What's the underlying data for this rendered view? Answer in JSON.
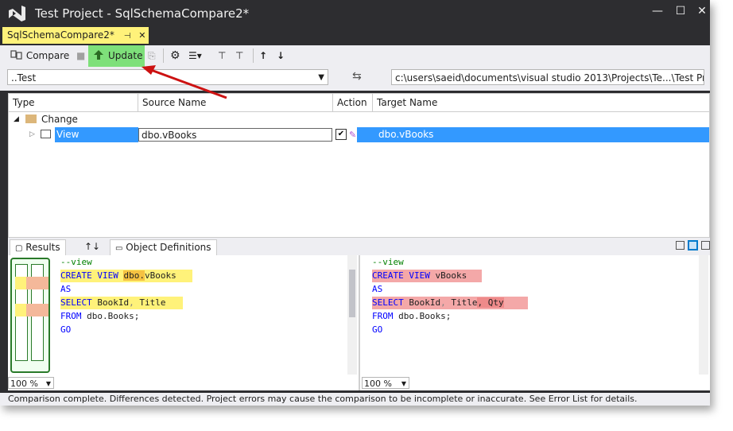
{
  "window": {
    "title": "Test Project - SqlSchemaCompare2*",
    "min": "—",
    "max": "☐",
    "close": "✕"
  },
  "doc_tab": {
    "label": "SqlSchemaCompare2*",
    "pin": "⊣",
    "close": "✕"
  },
  "toolbar": {
    "compare_label": "Compare",
    "update_label": "Update",
    "colors": {
      "update_highlight": "#7ee07a",
      "arrow": "#cc1111"
    }
  },
  "pathbar": {
    "source_value": "..Test",
    "swap_icon": "⇆",
    "target_value": "c:\\users\\saeid\\documents\\visual studio 2013\\Projects\\Te...\\Test Project"
  },
  "grid": {
    "headers": [
      "Type",
      "Source Name",
      "Action",
      "Target Name"
    ],
    "group_label": "Change",
    "row": {
      "type": "View",
      "source": "dbo.vBooks",
      "target": "dbo.vBooks",
      "checked": true
    }
  },
  "bottom_tabs": {
    "results": "Results",
    "sort": "↑↓",
    "object_definitions": "Object Definitions"
  },
  "source_code": {
    "lines": [
      {
        "t": [
          [
            "--view",
            "cm"
          ]
        ]
      },
      {
        "t": [
          [
            "CREATE VIEW ",
            "kw"
          ],
          [
            "dbo.",
            "hl-o"
          ],
          [
            "vBooks",
            ""
          ]
        ]
      },
      {
        "t": [
          [
            "AS",
            "kw"
          ]
        ]
      },
      {
        "t": [
          [
            "SELECT ",
            "kw"
          ],
          [
            "BookId",
            ""
          ],
          [
            ", ",
            "gry"
          ],
          [
            "Title",
            ""
          ]
        ]
      },
      {
        "t": [
          [
            "FROM ",
            "kw"
          ],
          [
            "dbo.Books;",
            ""
          ]
        ]
      },
      {
        "t": [
          [
            "GO",
            "kw"
          ]
        ]
      }
    ],
    "zoom": "100 %"
  },
  "target_code": {
    "lines": [
      {
        "t": [
          [
            "--view",
            "cm"
          ]
        ]
      },
      {
        "t": [
          [
            "CREATE VIEW ",
            "kw"
          ],
          [
            "vBooks",
            ""
          ]
        ]
      },
      {
        "t": [
          [
            "AS",
            "kw"
          ]
        ]
      },
      {
        "t": [
          [
            "SELECT ",
            "kw"
          ],
          [
            "BookId",
            ""
          ],
          [
            ", ",
            "gry"
          ],
          [
            "Title",
            ""
          ],
          [
            ", Qty",
            "hl-rd"
          ]
        ]
      },
      {
        "t": [
          [
            "FROM ",
            "kw"
          ],
          [
            "dbo.Books;",
            ""
          ]
        ]
      },
      {
        "t": [
          [
            "GO",
            "kw"
          ]
        ]
      }
    ],
    "zoom": "100 %"
  },
  "status": {
    "text": "Comparison complete. Differences detected. Project errors may cause the comparison to be incomplete or inaccurate. See Error List for details."
  }
}
